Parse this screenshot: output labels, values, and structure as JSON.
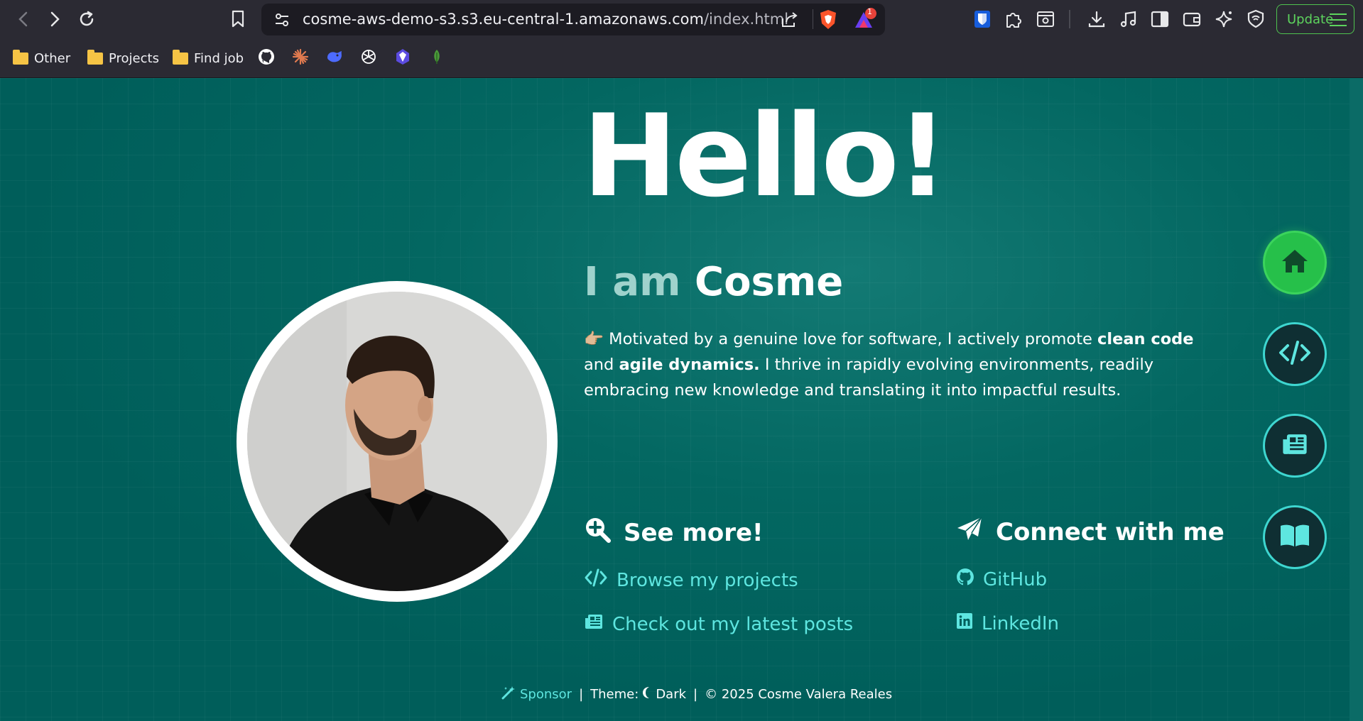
{
  "browser": {
    "url_host": "cosme-aws-demo-s3.s3.eu-central-1.amazonaws.com",
    "url_path": "/index.html",
    "update_label": "Update",
    "notification_count": "1",
    "bookmarks": [
      {
        "label": "Other",
        "type": "folder"
      },
      {
        "label": "Projects",
        "type": "folder"
      },
      {
        "label": "Find job",
        "type": "folder"
      }
    ],
    "bookmark_icons": [
      "github-icon",
      "claude-icon",
      "deepseek-icon",
      "chatgpt-icon",
      "perplexity-icon",
      "leaf-icon"
    ]
  },
  "hero": {
    "greeting": "Hello!",
    "iam_prefix": "I am",
    "name": "Cosme",
    "bio_emoji": "👉🏼",
    "bio_part1": " Motivated by a genuine love for software, I actively promote ",
    "bio_bold1": "clean code",
    "bio_part2": " and ",
    "bio_bold2": "agile dynamics.",
    "bio_part3": " I thrive in rapidly evolving environments, readily embracing new knowledge and translating it into impactful results."
  },
  "see_more": {
    "title": "See more!",
    "links": [
      {
        "label": "Browse my projects",
        "icon": "code-icon"
      },
      {
        "label": "Check out my latest posts",
        "icon": "newspaper-icon"
      }
    ]
  },
  "connect": {
    "title": "Connect with me",
    "links": [
      {
        "label": "GitHub",
        "icon": "github-icon"
      },
      {
        "label": "LinkedIn",
        "icon": "linkedin-icon"
      }
    ]
  },
  "footer": {
    "sponsor": "Sponsor",
    "separator": "|",
    "theme_label": "Theme:",
    "theme_value": "Dark",
    "copyright": "© 2025 Cosme Valera Reales"
  },
  "side_nav": [
    "home-icon",
    "code-icon",
    "newspaper-icon",
    "book-icon"
  ],
  "colors": {
    "background": "#005f5b",
    "accent": "#5ee6e0",
    "home_button": "#26c04a",
    "fab_border": "#3ed6d0"
  }
}
